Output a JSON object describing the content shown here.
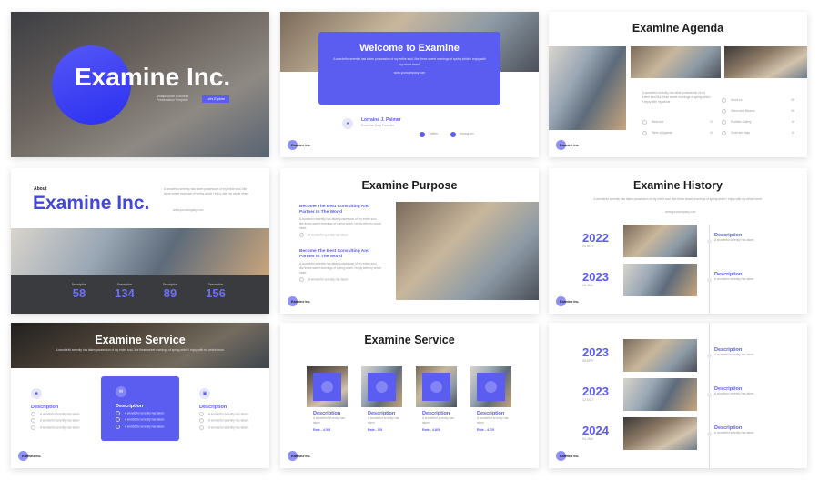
{
  "accent": "#5b5cf0",
  "brand": "Examine Inc.",
  "body_text": "A wonderful serenity has taken possession of my entire soul, like these sweet mornings of spring which I enjoy with my whole heart.",
  "short_text": "A wonderful serenity has taken",
  "website": "www.yourcompany.com",
  "slide1": {
    "title": "Examine Inc.",
    "subtitle": "Multipurpose Business Presentation Template",
    "button": "Let's Explore"
  },
  "slide2": {
    "title": "Welcome to Examine",
    "name": "Lorraine J. Palmer",
    "role": "Examine Corp Founder",
    "twitter": "Twitter",
    "instagram": "Instagram"
  },
  "slide3": {
    "title": "Examine Agenda",
    "intro": "A wonderful serenity has taken possession of my entire soul like these sweet mornings of spring which I enjoy with my whole",
    "items": [
      {
        "label": "Welcome",
        "page": "02"
      },
      {
        "label": "Table of Agenda",
        "page": "04"
      },
      {
        "label": "About us",
        "page": "05"
      },
      {
        "label": "Vision and Mission",
        "page": "06"
      },
      {
        "label": "Portfolio Gallery",
        "page": "15"
      },
      {
        "label": "Chart and map",
        "page": "19"
      }
    ]
  },
  "slide4": {
    "kicker": "About",
    "title": "Examine Inc.",
    "stats": [
      {
        "label": "Description",
        "value": "58"
      },
      {
        "label": "Description",
        "value": "134"
      },
      {
        "label": "Description",
        "value": "89"
      },
      {
        "label": "Description",
        "value": "156"
      }
    ]
  },
  "slide5": {
    "title": "Examine Purpose",
    "blocks": [
      {
        "heading": "Become The Best Consulting And Partner In The World"
      },
      {
        "heading": "Become The Best Consulting And Partner In The World"
      }
    ]
  },
  "slide6": {
    "title": "Examine History",
    "rows": [
      {
        "year": "2022",
        "date": "24 NOV",
        "desc": "Description"
      },
      {
        "year": "2023",
        "date": "19 JAN",
        "desc": "Description"
      }
    ]
  },
  "slide7": {
    "title": "Examine Service",
    "cols": [
      {
        "desc": "Description",
        "icon": "folder-icon"
      },
      {
        "desc": "Description",
        "icon": "mail-icon"
      },
      {
        "desc": "Description",
        "icon": "briefcase-icon"
      }
    ]
  },
  "slide8": {
    "title": "Examine Service",
    "cards": [
      {
        "desc": "Description",
        "rate": "Rate - 4.5/5"
      },
      {
        "desc": "Description",
        "rate": "Rate - 5/5"
      },
      {
        "desc": "Description",
        "rate": "Rate - 4.8/5"
      },
      {
        "desc": "Description",
        "rate": "Rate - 4.7/5"
      }
    ]
  },
  "slide9": {
    "rows": [
      {
        "year": "2023",
        "date": "08 APR",
        "desc": "Description"
      },
      {
        "year": "2023",
        "date": "12 OCT",
        "desc": "Description"
      },
      {
        "year": "2024",
        "date": "04 JAN",
        "desc": "Description"
      }
    ]
  }
}
